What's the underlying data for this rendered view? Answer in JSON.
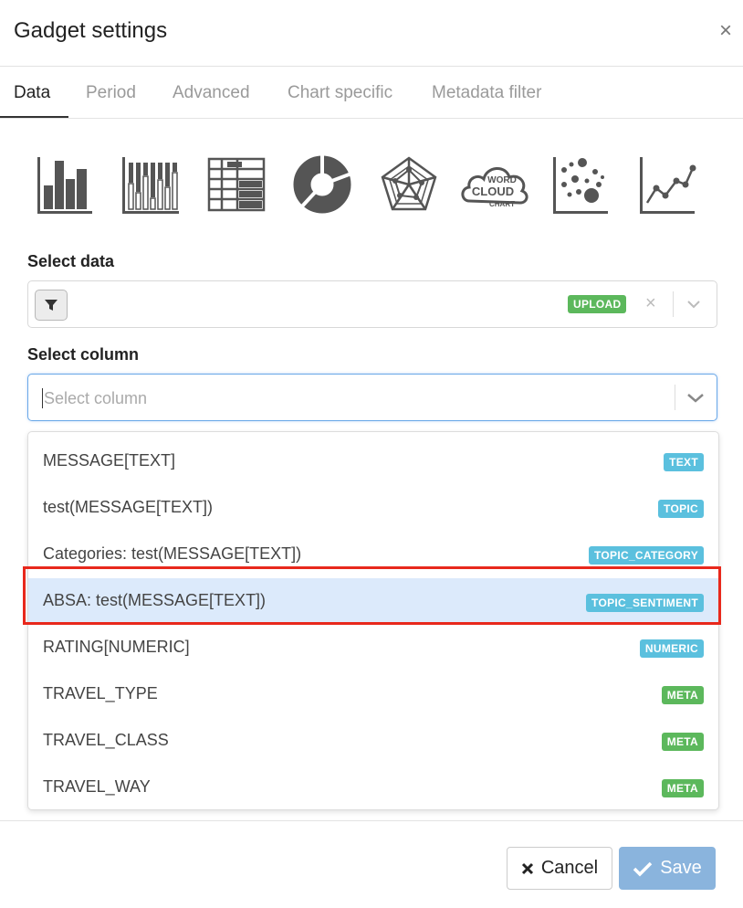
{
  "dialog": {
    "title": "Gadget settings",
    "close_glyph": "×"
  },
  "tabs": [
    {
      "label": "Data",
      "active": true
    },
    {
      "label": "Period",
      "active": false
    },
    {
      "label": "Advanced",
      "active": false
    },
    {
      "label": "Chart specific",
      "active": false
    },
    {
      "label": "Metadata filter",
      "active": false
    }
  ],
  "chart_types": [
    "bar-chart-icon",
    "stacked-bar-chart-icon",
    "table-icon",
    "donut-chart-icon",
    "radar-chart-icon",
    "word-cloud-chart-icon",
    "scatter-chart-icon",
    "line-chart-icon"
  ],
  "word_cloud_icon_text": {
    "line1": "WORD",
    "line2": "CLOUD",
    "line3": "CHART"
  },
  "select_data": {
    "label": "Select data",
    "badge": "UPLOAD",
    "clear_glyph": "×"
  },
  "select_column": {
    "label": "Select column",
    "placeholder": "Select column",
    "options": [
      {
        "text": "MESSAGE[TEXT]",
        "badge": "TEXT",
        "badge_color": "#5bc0de"
      },
      {
        "text": "test(MESSAGE[TEXT])",
        "badge": "TOPIC",
        "badge_color": "#5bc0de"
      },
      {
        "text": "Categories: test(MESSAGE[TEXT])",
        "badge": "TOPIC_CATEGORY",
        "badge_color": "#5bc0de"
      },
      {
        "text": "ABSA: test(MESSAGE[TEXT])",
        "badge": "TOPIC_SENTIMENT",
        "badge_color": "#5bc0de",
        "highlighted": true
      },
      {
        "text": "RATING[NUMERIC]",
        "badge": "NUMERIC",
        "badge_color": "#5bc0de"
      },
      {
        "text": "TRAVEL_TYPE",
        "badge": "META",
        "badge_color": "#5cb85c"
      },
      {
        "text": "TRAVEL_CLASS",
        "badge": "META",
        "badge_color": "#5cb85c"
      },
      {
        "text": "TRAVEL_WAY",
        "badge": "META",
        "badge_color": "#5cb85c"
      }
    ]
  },
  "footer": {
    "cancel_label": "Cancel",
    "save_label": "Save"
  },
  "colors": {
    "accent": "#8ab4dd",
    "highlight_border": "#e8281c",
    "icon": "#555555"
  }
}
